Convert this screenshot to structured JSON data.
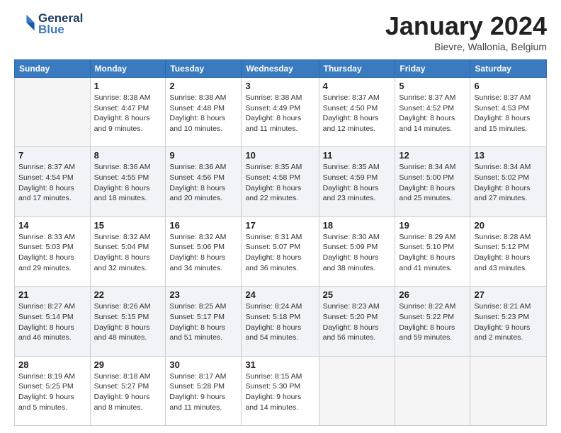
{
  "header": {
    "logo_line1": "General",
    "logo_line2": "Blue",
    "month_title": "January 2024",
    "subtitle": "Bievre, Wallonia, Belgium"
  },
  "weekdays": [
    "Sunday",
    "Monday",
    "Tuesday",
    "Wednesday",
    "Thursday",
    "Friday",
    "Saturday"
  ],
  "weeks": [
    [
      {
        "day": "",
        "info": ""
      },
      {
        "day": "1",
        "info": "Sunrise: 8:38 AM\nSunset: 4:47 PM\nDaylight: 8 hours\nand 9 minutes."
      },
      {
        "day": "2",
        "info": "Sunrise: 8:38 AM\nSunset: 4:48 PM\nDaylight: 8 hours\nand 10 minutes."
      },
      {
        "day": "3",
        "info": "Sunrise: 8:38 AM\nSunset: 4:49 PM\nDaylight: 8 hours\nand 11 minutes."
      },
      {
        "day": "4",
        "info": "Sunrise: 8:37 AM\nSunset: 4:50 PM\nDaylight: 8 hours\nand 12 minutes."
      },
      {
        "day": "5",
        "info": "Sunrise: 8:37 AM\nSunset: 4:52 PM\nDaylight: 8 hours\nand 14 minutes."
      },
      {
        "day": "6",
        "info": "Sunrise: 8:37 AM\nSunset: 4:53 PM\nDaylight: 8 hours\nand 15 minutes."
      }
    ],
    [
      {
        "day": "7",
        "info": "Sunrise: 8:37 AM\nSunset: 4:54 PM\nDaylight: 8 hours\nand 17 minutes."
      },
      {
        "day": "8",
        "info": "Sunrise: 8:36 AM\nSunset: 4:55 PM\nDaylight: 8 hours\nand 18 minutes."
      },
      {
        "day": "9",
        "info": "Sunrise: 8:36 AM\nSunset: 4:56 PM\nDaylight: 8 hours\nand 20 minutes."
      },
      {
        "day": "10",
        "info": "Sunrise: 8:35 AM\nSunset: 4:58 PM\nDaylight: 8 hours\nand 22 minutes."
      },
      {
        "day": "11",
        "info": "Sunrise: 8:35 AM\nSunset: 4:59 PM\nDaylight: 8 hours\nand 23 minutes."
      },
      {
        "day": "12",
        "info": "Sunrise: 8:34 AM\nSunset: 5:00 PM\nDaylight: 8 hours\nand 25 minutes."
      },
      {
        "day": "13",
        "info": "Sunrise: 8:34 AM\nSunset: 5:02 PM\nDaylight: 8 hours\nand 27 minutes."
      }
    ],
    [
      {
        "day": "14",
        "info": "Sunrise: 8:33 AM\nSunset: 5:03 PM\nDaylight: 8 hours\nand 29 minutes."
      },
      {
        "day": "15",
        "info": "Sunrise: 8:32 AM\nSunset: 5:04 PM\nDaylight: 8 hours\nand 32 minutes."
      },
      {
        "day": "16",
        "info": "Sunrise: 8:32 AM\nSunset: 5:06 PM\nDaylight: 8 hours\nand 34 minutes."
      },
      {
        "day": "17",
        "info": "Sunrise: 8:31 AM\nSunset: 5:07 PM\nDaylight: 8 hours\nand 36 minutes."
      },
      {
        "day": "18",
        "info": "Sunrise: 8:30 AM\nSunset: 5:09 PM\nDaylight: 8 hours\nand 38 minutes."
      },
      {
        "day": "19",
        "info": "Sunrise: 8:29 AM\nSunset: 5:10 PM\nDaylight: 8 hours\nand 41 minutes."
      },
      {
        "day": "20",
        "info": "Sunrise: 8:28 AM\nSunset: 5:12 PM\nDaylight: 8 hours\nand 43 minutes."
      }
    ],
    [
      {
        "day": "21",
        "info": "Sunrise: 8:27 AM\nSunset: 5:14 PM\nDaylight: 8 hours\nand 46 minutes."
      },
      {
        "day": "22",
        "info": "Sunrise: 8:26 AM\nSunset: 5:15 PM\nDaylight: 8 hours\nand 48 minutes."
      },
      {
        "day": "23",
        "info": "Sunrise: 8:25 AM\nSunset: 5:17 PM\nDaylight: 8 hours\nand 51 minutes."
      },
      {
        "day": "24",
        "info": "Sunrise: 8:24 AM\nSunset: 5:18 PM\nDaylight: 8 hours\nand 54 minutes."
      },
      {
        "day": "25",
        "info": "Sunrise: 8:23 AM\nSunset: 5:20 PM\nDaylight: 8 hours\nand 56 minutes."
      },
      {
        "day": "26",
        "info": "Sunrise: 8:22 AM\nSunset: 5:22 PM\nDaylight: 8 hours\nand 59 minutes."
      },
      {
        "day": "27",
        "info": "Sunrise: 8:21 AM\nSunset: 5:23 PM\nDaylight: 9 hours\nand 2 minutes."
      }
    ],
    [
      {
        "day": "28",
        "info": "Sunrise: 8:19 AM\nSunset: 5:25 PM\nDaylight: 9 hours\nand 5 minutes."
      },
      {
        "day": "29",
        "info": "Sunrise: 8:18 AM\nSunset: 5:27 PM\nDaylight: 9 hours\nand 8 minutes."
      },
      {
        "day": "30",
        "info": "Sunrise: 8:17 AM\nSunset: 5:28 PM\nDaylight: 9 hours\nand 11 minutes."
      },
      {
        "day": "31",
        "info": "Sunrise: 8:15 AM\nSunset: 5:30 PM\nDaylight: 9 hours\nand 14 minutes."
      },
      {
        "day": "",
        "info": ""
      },
      {
        "day": "",
        "info": ""
      },
      {
        "day": "",
        "info": ""
      }
    ]
  ]
}
